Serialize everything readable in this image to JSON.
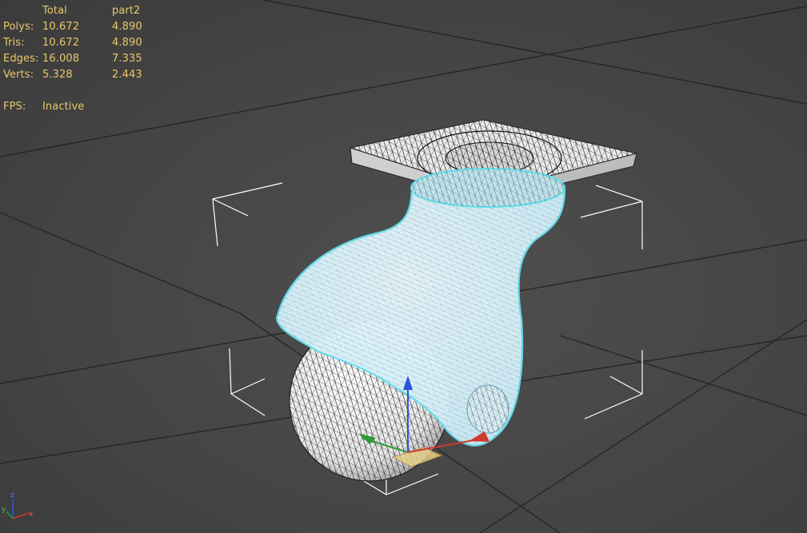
{
  "stats": {
    "header": {
      "label": "",
      "total": "Total",
      "selection": "part2"
    },
    "rows": [
      {
        "label": "Polys:",
        "total": "10.672",
        "selection": "4.890"
      },
      {
        "label": "Tris:",
        "total": "10.672",
        "selection": "4.890"
      },
      {
        "label": "Edges:",
        "total": "16.008",
        "selection": "7.335"
      },
      {
        "label": "Verts:",
        "total": "5.328",
        "selection": "2.443"
      }
    ],
    "fps": {
      "label": "FPS:",
      "value": "Inactive"
    }
  },
  "colors": {
    "stats_text": "#e9c86a",
    "grid": "#262626",
    "selection_fill": "#cfeef8",
    "selection_outline": "#5fe0ee",
    "wire": "#111111",
    "bracket": "#ffffff",
    "axis_x": "#d03a2a",
    "axis_y": "#2f9a3a",
    "axis_z": "#2856d8",
    "plane_handle": "#e6d08a"
  },
  "scene": {
    "objects": [
      "caster-mount-plate",
      "caster-fork",
      "caster-wheel"
    ],
    "selected_object": "part2",
    "viewport_axes": [
      "x",
      "y",
      "z"
    ]
  }
}
